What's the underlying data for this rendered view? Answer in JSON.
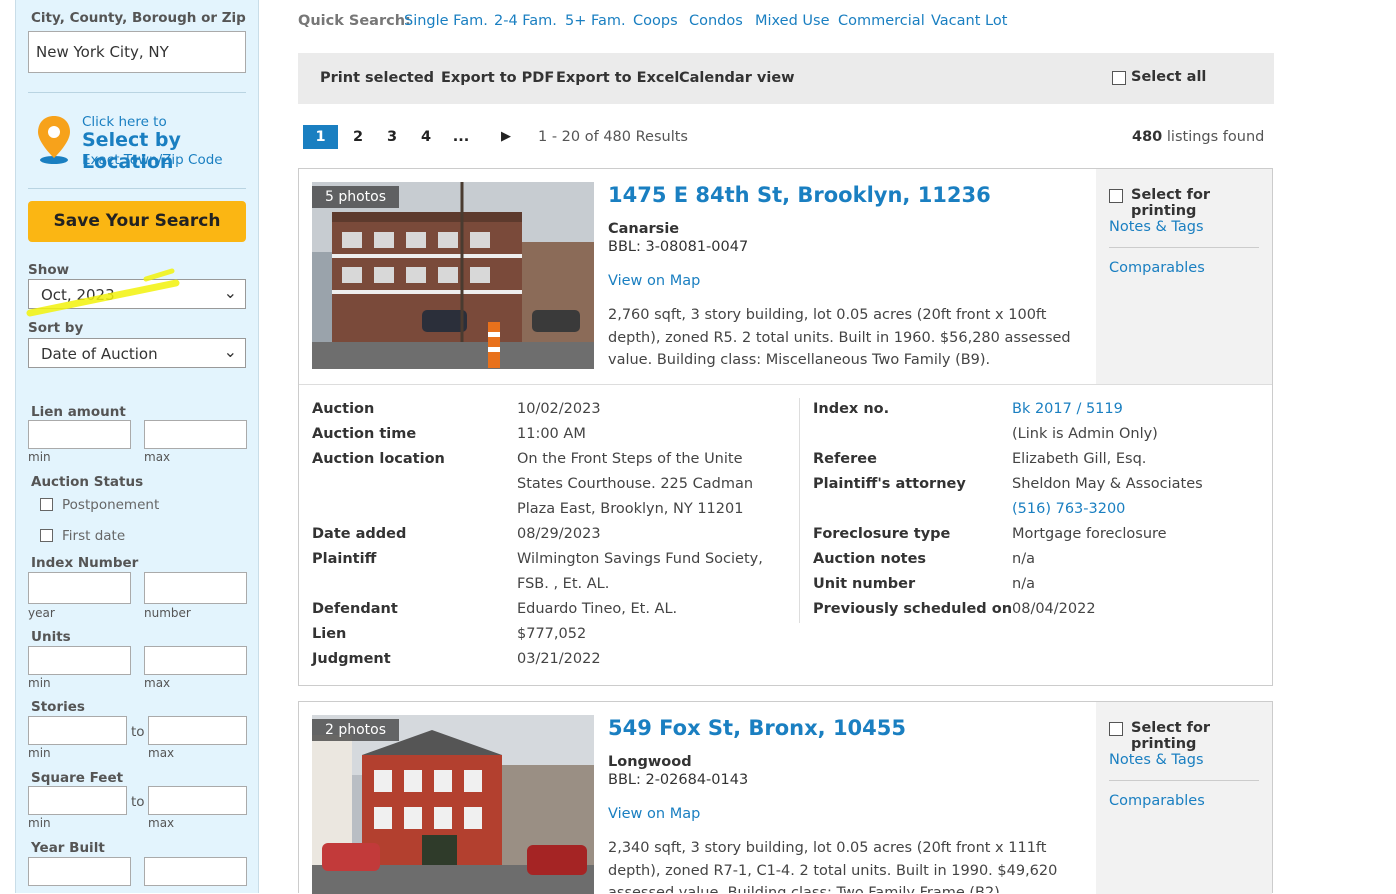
{
  "sidebar": {
    "location_label": "City, County, Borough or Zip",
    "location_value": "New York City, NY",
    "click_here": "Click here to",
    "select_by_location": "Select by Location",
    "exact_town": "Exact Town/Zip Code",
    "save_search": "Save Your Search",
    "show_label": "Show",
    "show_value": "Oct, 2023",
    "sort_label": "Sort by",
    "sort_value": "Date of Auction",
    "lien_label": "Lien amount",
    "min": "min",
    "max": "max",
    "auction_status_label": "Auction Status",
    "postponement": "Postponement",
    "first_date": "First date",
    "index_number_label": "Index Number",
    "year": "year",
    "number": "number",
    "units_label": "Units",
    "stories_label": "Stories",
    "to": "to",
    "sqft_label": "Square Feet",
    "year_built_label": "Year Built"
  },
  "quick_search": {
    "label": "Quick Search:",
    "links": [
      "Single Fam.",
      "2-4 Fam.",
      "5+ Fam.",
      "Coops",
      "Condos",
      "Mixed Use",
      "Commercial",
      "Vacant Lot"
    ]
  },
  "toolbar": {
    "print_selected": "Print selected",
    "export_pdf": "Export to PDF",
    "export_excel": "Export to Excel",
    "calendar_view": "Calendar view",
    "select_all": "Select all"
  },
  "pagination": {
    "pages": [
      "1",
      "2",
      "3",
      "4",
      "..."
    ],
    "next": "▶",
    "results": "1 - 20 of 480 Results",
    "count": "480",
    "found": "listings found"
  },
  "listings": [
    {
      "photos": "5 photos",
      "address": "1475 E 84th St, Brooklyn, 11236",
      "neighborhood": "Canarsie",
      "bbl": "BBL: 3-08081-0047",
      "view_map": "View on Map",
      "description": "2,760 sqft, 3 story building, lot 0.05 acres (20ft front x 100ft depth), zoned R5. 2 total units. Built in 1960. $56,280 assessed value. Building class: Miscellaneous Two Family (B9).",
      "select_print": "Select for printing",
      "notes_tags": "Notes & Tags",
      "comparables": "Comparables",
      "details_left": {
        "auction_k": "Auction",
        "auction_v": "10/02/2023",
        "time_k": "Auction time",
        "time_v": "11:00 AM",
        "loc_k": "Auction location",
        "loc_v1": "On the Front Steps of the Unite",
        "loc_v2": "States Courthouse. 225 Cadman",
        "loc_v3": "Plaza East, Brooklyn, NY 11201",
        "added_k": "Date added",
        "added_v": "08/29/2023",
        "plaintiff_k": "Plaintiff",
        "plaintiff_v1": "Wilmington Savings Fund Society,",
        "plaintiff_v2": "FSB. , Et. AL.",
        "defendant_k": "Defendant",
        "defendant_v": "Eduardo Tineo, Et. AL.",
        "lien_k": "Lien",
        "lien_v": "$777,052",
        "judgment_k": "Judgment",
        "judgment_v": "03/21/2022"
      },
      "details_right": {
        "index_k": "Index no.",
        "index_v": "Bk 2017 / 5119",
        "index_note": "(Link is Admin Only)",
        "referee_k": "Referee",
        "referee_v": "Elizabeth Gill, Esq.",
        "attorney_k": "Plaintiff's attorney",
        "attorney_v": "Sheldon May & Associates",
        "attorney_phone": "(516) 763-3200",
        "fc_type_k": "Foreclosure type",
        "fc_type_v": "Mortgage foreclosure",
        "notes_k": "Auction notes",
        "notes_v": "n/a",
        "unit_k": "Unit number",
        "unit_v": "n/a",
        "prev_k": "Previously scheduled on",
        "prev_v": "08/04/2022"
      }
    },
    {
      "photos": "2 photos",
      "address": "549 Fox St, Bronx, 10455",
      "neighborhood": "Longwood",
      "bbl": "BBL: 2-02684-0143",
      "view_map": "View on Map",
      "description": "2,340 sqft, 3 story building, lot 0.05 acres (20ft front x 111ft depth), zoned R7-1, C1-4. 2 total units. Built in 1990. $49,620 assessed value. Building class: Two Family Frame (B2).",
      "select_print": "Select for printing",
      "notes_tags": "Notes & Tags",
      "comparables": "Comparables"
    }
  ]
}
